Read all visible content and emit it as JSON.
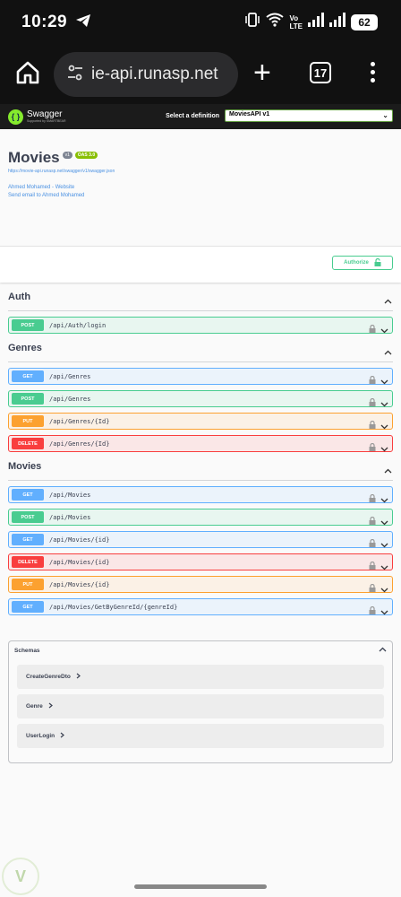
{
  "status": {
    "time": "10:29",
    "battery": "62",
    "network": [
      "Vo",
      "LTE"
    ]
  },
  "browser": {
    "url": "ie-api.runasp.net",
    "tab_count": "17"
  },
  "swagger": {
    "logo_text": "Swagger",
    "logo_sub": "Supported by SMARTBEAR",
    "definition_label": "Select a definition",
    "definition_value": "MoviesAPI v1",
    "title": "Movies",
    "version_badge": "v1",
    "oas_badge": "OAS 3.0",
    "spec_url": "https://movie-api.runasp.net/swagger/v1/swagger.json",
    "contact_website": "Ahmed Mohamed - Website",
    "contact_email": "Send email to Ahmed Mohamed",
    "authorize_label": "Authorize"
  },
  "colors": {
    "GET": {
      "bg": "#ebf3fb",
      "border": "#61affe"
    },
    "POST": {
      "bg": "#e8f6f0",
      "border": "#49cc90"
    },
    "PUT": {
      "bg": "#fbf1e6",
      "border": "#fca130"
    },
    "DELETE": {
      "bg": "#fae7e7",
      "border": "#f93e3e"
    }
  },
  "tags": [
    {
      "name": "Auth",
      "ops": [
        {
          "method": "POST",
          "path": "/api/Auth/login"
        }
      ]
    },
    {
      "name": "Genres",
      "ops": [
        {
          "method": "GET",
          "path": "/api/Genres"
        },
        {
          "method": "POST",
          "path": "/api/Genres"
        },
        {
          "method": "PUT",
          "path": "/api/Genres/{Id}"
        },
        {
          "method": "DELETE",
          "path": "/api/Genres/{Id}"
        }
      ]
    },
    {
      "name": "Movies",
      "ops": [
        {
          "method": "GET",
          "path": "/api/Movies"
        },
        {
          "method": "POST",
          "path": "/api/Movies"
        },
        {
          "method": "GET",
          "path": "/api/Movies/{id}"
        },
        {
          "method": "DELETE",
          "path": "/api/Movies/{id}"
        },
        {
          "method": "PUT",
          "path": "/api/Movies/{id}"
        },
        {
          "method": "GET",
          "path": "/api/Movies/GetByGenreId/{genreId}"
        }
      ]
    }
  ],
  "schemas": {
    "title": "Schemas",
    "items": [
      "CreateGenreDto",
      "Genre",
      "UserLogin"
    ]
  }
}
